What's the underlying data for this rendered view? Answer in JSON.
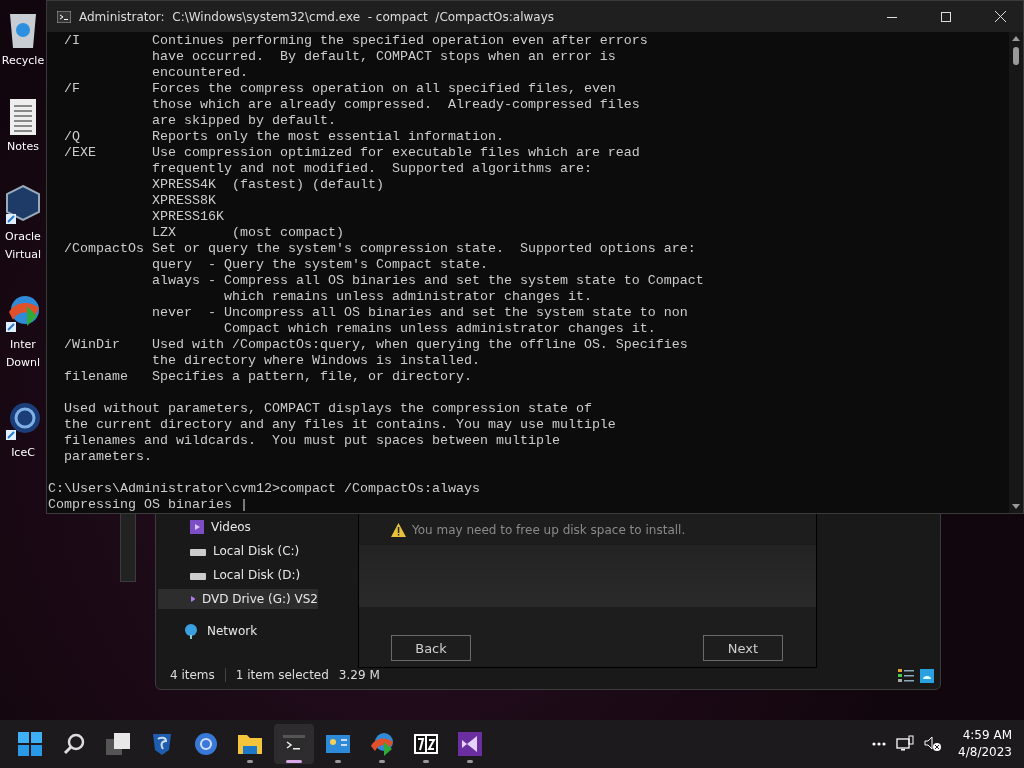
{
  "desktop_icons": [
    {
      "kind": "recycle",
      "lines": [
        "Recycle"
      ]
    },
    {
      "kind": "notes",
      "lines": [
        "Notes"
      ]
    },
    {
      "kind": "cube",
      "lines": [
        "Oracle",
        "Virtual"
      ]
    },
    {
      "kind": "globe",
      "lines": [
        "Inter",
        "Downl"
      ]
    },
    {
      "kind": "disc",
      "lines": [
        "IceC"
      ]
    }
  ],
  "console": {
    "title": "Administrator:  C:\\Windows\\system32\\cmd.exe  - compact  /CompactOs:always",
    "blocks": [
      [
        "  /I         Continues performing the specified operation even after errors",
        "             have occurred.  By default, COMPACT stops when an error is",
        "             encountered.",
        "  /F         Forces the compress operation on all specified files, even",
        "             those which are already compressed.  Already-compressed files",
        "             are skipped by default.",
        "  /Q         Reports only the most essential information.",
        "  /EXE       Use compression optimized for executable files which are read",
        "             frequently and not modified.  Supported algorithms are:",
        "             XPRESS4K  (fastest) (default)",
        "             XPRESS8K",
        "             XPRESS16K",
        "             LZX       (most compact)",
        "  /CompactOs Set or query the system's compression state.  Supported options are:",
        "             query  - Query the system's Compact state.",
        "             always - Compress all OS binaries and set the system state to Compact",
        "                      which remains unless administrator changes it.",
        "             never  - Uncompress all OS binaries and set the system state to non",
        "                      Compact which remains unless administrator changes it.",
        "  /WinDir    Used with /CompactOs:query, when querying the offline OS. Specifies",
        "             the directory where Windows is installed.",
        "  filename   Specifies a pattern, file, or directory."
      ],
      [
        "  Used without parameters, COMPACT displays the compression state of",
        "  the current directory and any files it contains. You may use multiple",
        "  filenames and wildcards.  You must put spaces between multiple",
        "  parameters."
      ],
      [
        "C:\\Users\\Administrator\\cvm12>compact /CompactOs:always",
        "Compressing OS binaries |"
      ]
    ]
  },
  "explorer": {
    "nav": [
      {
        "kind": "videos",
        "label": "Videos",
        "selected": false
      },
      {
        "kind": "disk",
        "label": "Local Disk (C:)",
        "selected": false
      },
      {
        "kind": "disk",
        "label": "Local Disk (D:)",
        "selected": false
      },
      {
        "kind": "vs",
        "label": "DVD Drive (G:) VS2",
        "selected": true
      },
      {
        "kind": "network",
        "label": "Network",
        "selected": false
      }
    ],
    "status": [
      "4 items",
      "1 item selected",
      "3.29 M"
    ]
  },
  "installer": {
    "warning": "You may need to free up disk space to install.",
    "buttons": [
      "Back",
      "Next"
    ]
  },
  "taskbar": {
    "apps": [
      {
        "kind": "start",
        "running": false,
        "selected": false
      },
      {
        "kind": "search",
        "running": false,
        "selected": false
      },
      {
        "kind": "taskview",
        "running": false,
        "selected": false
      },
      {
        "kind": "shield",
        "running": false,
        "selected": false
      },
      {
        "kind": "browser",
        "running": false,
        "selected": false
      },
      {
        "kind": "folder",
        "running": true,
        "selected": false
      },
      {
        "kind": "terminal",
        "running": true,
        "selected": true
      },
      {
        "kind": "remote",
        "running": true,
        "selected": false
      },
      {
        "kind": "globe",
        "running": true,
        "selected": false
      },
      {
        "kind": "archive",
        "running": true,
        "selected": false
      },
      {
        "kind": "vs",
        "running": true,
        "selected": false
      }
    ],
    "time": "4:59 AM",
    "date": "4/8/2023"
  }
}
